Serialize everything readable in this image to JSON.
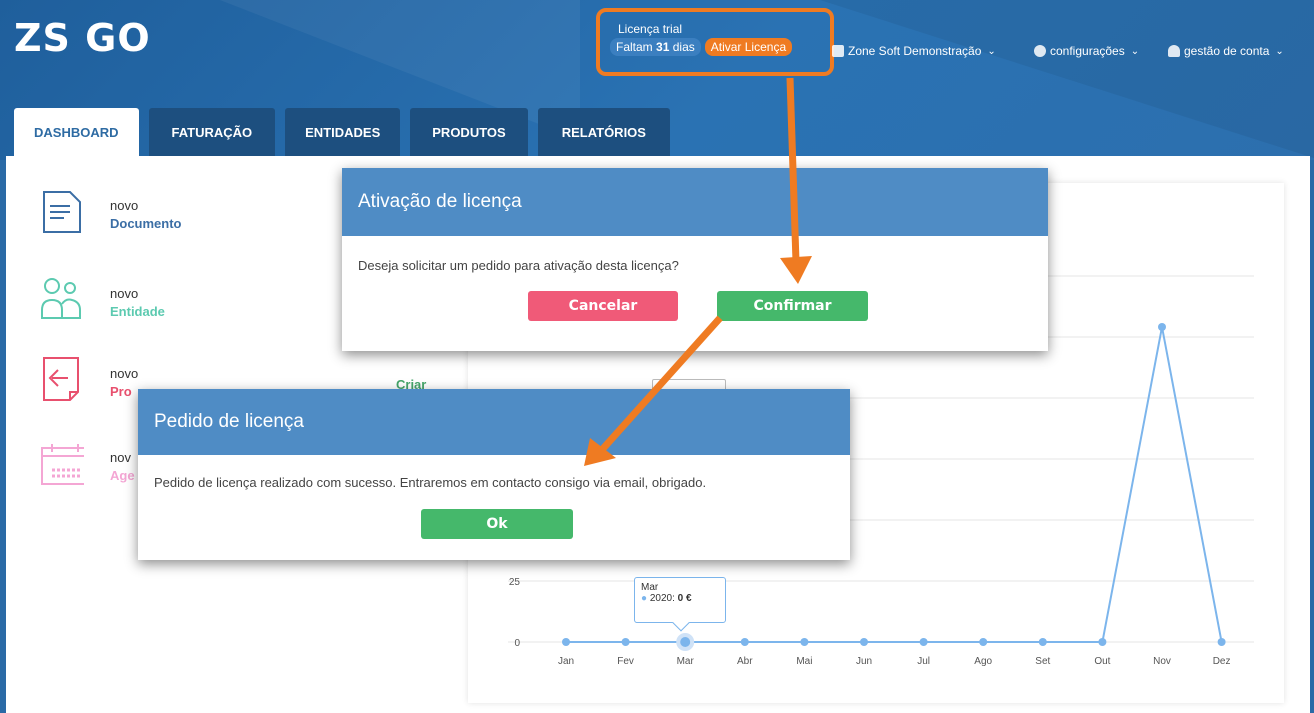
{
  "app": {
    "logo": "ZS GO"
  },
  "license": {
    "trial_label": "Licença trial",
    "days_prefix": "Faltam",
    "days_count": "31",
    "days_suffix": "dias",
    "activate_label": "Ativar Licença"
  },
  "topnav": {
    "company": "Zone Soft Demonstração",
    "settings": "configurações",
    "account": "gestão de conta"
  },
  "tabs": [
    "DASHBOARD",
    "FATURAÇÃO",
    "ENTIDADES",
    "PRODUTOS",
    "RELATÓRIOS"
  ],
  "quick_actions": [
    {
      "prefix": "novo",
      "label": "Documento",
      "color": "#3b6ea5"
    },
    {
      "prefix": "novo",
      "label": "Entidade",
      "color": "#5ccab0"
    },
    {
      "prefix": "novo",
      "label": "Pro",
      "color": "#e8506e"
    },
    {
      "prefix": "nov",
      "label": "Age",
      "color": "#f4a6d4"
    }
  ],
  "criar_label": "Criar",
  "dialog_activation": {
    "title": "Ativação de licença",
    "message": "Deseja solicitar um pedido para ativação desta licença?",
    "cancel_label": "Cancelar",
    "confirm_label": "Confirmar"
  },
  "dialog_request": {
    "title": "Pedido de licença",
    "message": "Pedido de licença realizado com sucesso. Entraremos em contacto consigo via email, obrigado.",
    "ok_label": "Ok"
  },
  "tooltip": {
    "month": "Mar",
    "series": "2020:",
    "value": "0 €"
  },
  "colors": {
    "accent_orange": "#ef7b22",
    "header_blue": "#2a6aa6",
    "series": "#7cb5ec"
  },
  "chart_data": {
    "type": "line",
    "categories": [
      "Jan",
      "Fev",
      "Mar",
      "Abr",
      "Mai",
      "Jun",
      "Jul",
      "Ago",
      "Set",
      "Out",
      "Nov",
      "Dez"
    ],
    "series": [
      {
        "name": "2020",
        "values": [
          0,
          0,
          0,
          0,
          0,
          0,
          0,
          0,
          0,
          0,
          126,
          0
        ]
      }
    ],
    "yticks_visible": [
      "0",
      "25"
    ],
    "ylim": [
      0,
      150
    ],
    "grid": true
  }
}
